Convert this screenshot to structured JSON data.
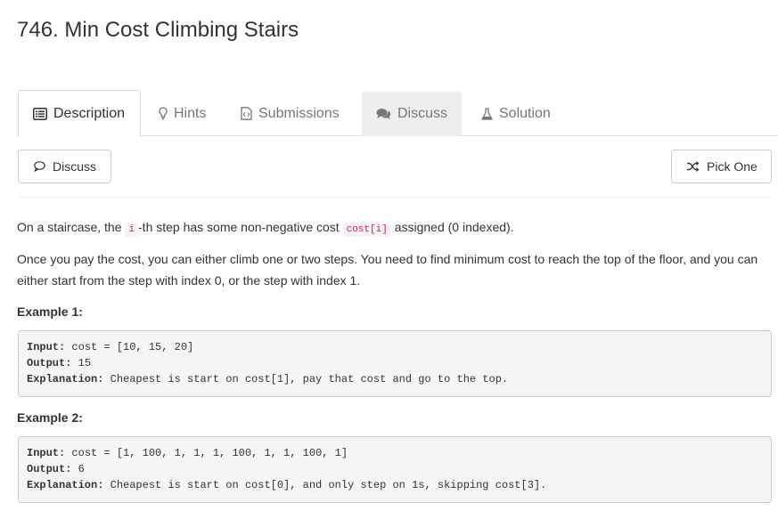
{
  "problem": {
    "title": "746. Min Cost Climbing Stairs"
  },
  "tabs": [
    {
      "label": "Description",
      "icon": "list-alt-icon",
      "active": true
    },
    {
      "label": "Hints",
      "icon": "lightbulb-icon"
    },
    {
      "label": "Submissions",
      "icon": "file-code-icon"
    },
    {
      "label": "Discuss",
      "icon": "comments-icon",
      "shaded": true
    },
    {
      "label": "Solution",
      "icon": "flask-icon"
    }
  ],
  "toolbar": {
    "discuss_label": "Discuss",
    "pick_one_label": "Pick One"
  },
  "description": {
    "p1_before": "On a staircase, the ",
    "p1_code1": "i",
    "p1_middle": "-th step has some non-negative cost ",
    "p1_code2": "cost[i]",
    "p1_after": " assigned (0 indexed).",
    "p2": "Once you pay the cost, you can either climb one or two steps. You need to find minimum cost to reach the top of the floor, and you can either start from the step with index 0, or the step with index 1."
  },
  "examples": [
    {
      "label": "Example 1:",
      "input_label": "Input:",
      "input": " cost = [10, 15, 20]",
      "output_label": "Output:",
      "output": " 15",
      "explanation_label": "Explanation:",
      "explanation": " Cheapest is start on cost[1], pay that cost and go to the top."
    },
    {
      "label": "Example 2:",
      "input_label": "Input:",
      "input": " cost = [1, 100, 1, 1, 1, 100, 1, 1, 100, 1]",
      "output_label": "Output:",
      "output": " 6",
      "explanation_label": "Explanation:",
      "explanation": " Cheapest is start on cost[0], and only step on 1s, skipping cost[3]."
    }
  ],
  "colors": {
    "code_text": "#c7254e",
    "code_bg": "#f9f2f4",
    "tab_shaded_bg": "#eeeeee"
  }
}
